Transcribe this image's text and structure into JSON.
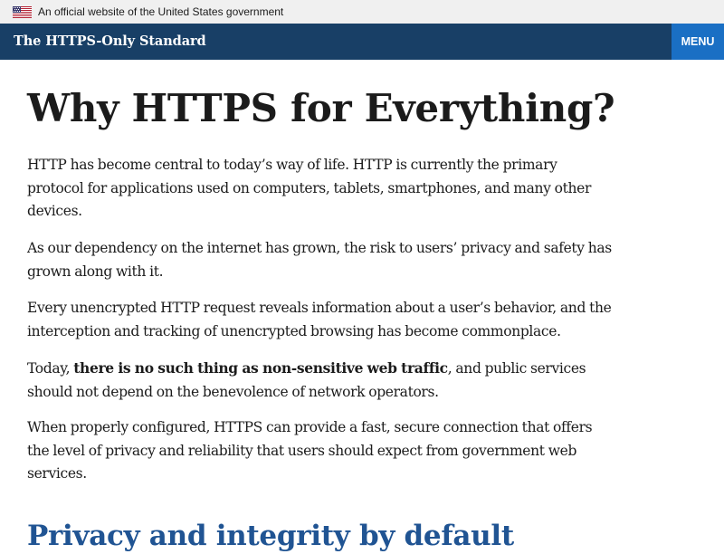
{
  "gov_banner": {
    "flag_icon": "us-flag-icon",
    "text": "An official website of the United States government"
  },
  "header": {
    "site_title": "The HTTPS-Only Standard",
    "menu_label": "MENU"
  },
  "colors": {
    "header_bg": "#183f66",
    "menu_bg": "#1a6fc4",
    "banner_bg": "#f0f0f0",
    "section_heading": "#205493",
    "text": "#1b1b1b"
  },
  "main": {
    "title": "Why HTTPS for Everything?",
    "paragraphs": {
      "p1": "HTTP has become central to today’s way of life. HTTP is currently the primary protocol for applications used on computers, tablets, smartphones, and many other devices.",
      "p2": "As our dependency on the internet has grown, the risk to users’ privacy and safety has grown along with it.",
      "p3": "Every unencrypted HTTP request reveals information about a user’s behavior, and the interception and tracking of unencrypted browsing has become commonplace.",
      "p4_before": "Today, ",
      "p4_bold": "there is no such thing as non-sensitive web traffic",
      "p4_after": ", and public services should not depend on the benevolence of network operators.",
      "p5": "When properly configured, HTTPS can provide a fast, secure connection that offers the level of privacy and reliability that users should expect from government web services."
    },
    "section_heading": "Privacy and integrity by default"
  }
}
